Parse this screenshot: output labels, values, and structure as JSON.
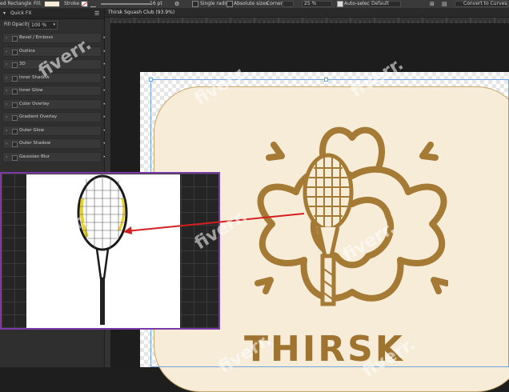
{
  "toolbar": {
    "tool_label": "ed Rectangle",
    "fill_label": "Fill:",
    "stroke_label": "Stroke:",
    "stroke_width": "16 pt",
    "single_radius_label": "Single radius",
    "absolute_sizes_label": "Absolute sizes",
    "corner_label": "Corner:",
    "corner_value": "25 %",
    "auto_select_label": "Auto-select:",
    "auto_select_value": "Default",
    "convert_label": "Convert to Curves",
    "fill_color": "#f6ecd8"
  },
  "panel": {
    "tab_label": "Quick FX",
    "fill_opacity_label": "Fill Opacity:",
    "fill_opacity_value": "100 %",
    "effects": [
      "Bevel / Emboss",
      "Outline",
      "3D",
      "Inner Shadow",
      "Inner Glow",
      "Color Overlay",
      "Gradient Overlay",
      "Outer Glow",
      "Outer Shadow",
      "Gaussian Blur"
    ]
  },
  "document": {
    "tab_title": "Thirsk Squash Club (93.9%)"
  },
  "artwork": {
    "logo_text": "THIRSK",
    "gold_color": "#a57a34",
    "badge_color": "#f6ecd8"
  },
  "watermark": "fiverr."
}
